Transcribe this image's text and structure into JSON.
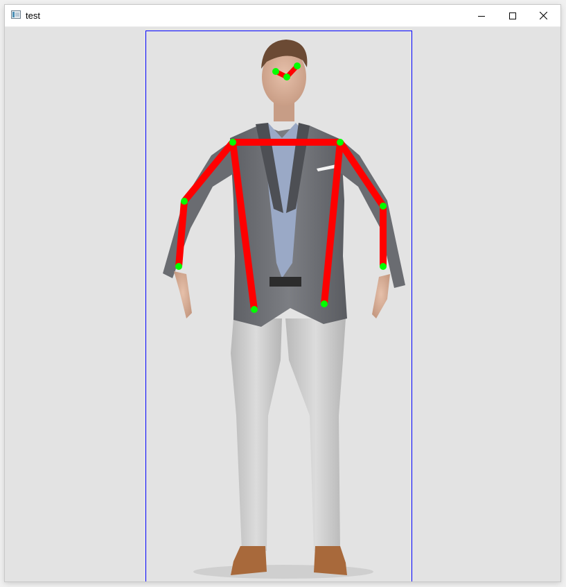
{
  "window": {
    "title": "test",
    "icon": "app-window-icon"
  },
  "controls": {
    "minimize_icon": "minimize-icon",
    "maximize_icon": "maximize-icon",
    "close_icon": "close-icon"
  },
  "colors": {
    "bounding_box": "#0000ff",
    "skeleton_line": "#ff0000",
    "keypoint": "#00ff00",
    "background": "#e3e3e3"
  }
}
